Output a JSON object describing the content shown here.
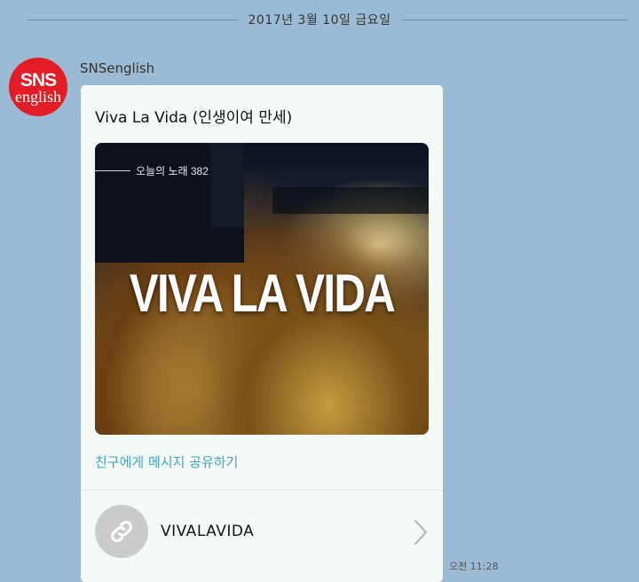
{
  "date_separator": "2017년 3월 10일 금요일",
  "sender": {
    "name": "SNSenglish",
    "avatar_line1": "SNS",
    "avatar_line2": "english"
  },
  "card": {
    "title": "Viva La Vida (인생이여 만세)",
    "image_subtitle": "오늘의 노래 382",
    "image_headline": "VIVA LA VIDA",
    "share_label": "친구에게 메시지 공유하기",
    "link_label": "VIVALAVIDA"
  },
  "timestamp": "오전 11:28",
  "colors": {
    "chat_background": "#9bbbd4",
    "accent_link": "#38a7c2",
    "avatar_red": "#e21d25"
  },
  "icons": {
    "link": "link-icon",
    "chevron": "chevron-right-icon"
  }
}
